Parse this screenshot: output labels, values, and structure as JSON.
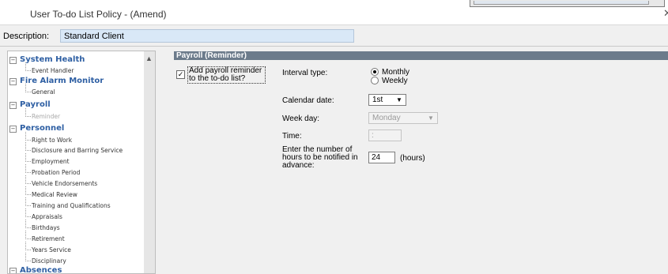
{
  "window": {
    "title": "User To-do List Policy - (Amend)",
    "close_glyph": "✕"
  },
  "description": {
    "label": "Description:",
    "value": "Standard Client"
  },
  "tree": {
    "categories": [
      {
        "label": "System Health",
        "children": [
          "Event Handler"
        ]
      },
      {
        "label": "Fire Alarm Monitor",
        "children": [
          "General"
        ]
      },
      {
        "label": "Payroll",
        "children": [
          "Reminder"
        ],
        "selected_child": "Reminder"
      },
      {
        "label": "Personnel",
        "children": [
          "Right to Work",
          "Disclosure and Barring Service",
          "Employment",
          "Probation Period",
          "Vehicle Endorsements",
          "Medical Review",
          "Training and Qualifications",
          "Appraisals",
          "Birthdays",
          "Retirement",
          "Years Service",
          "Disciplinary"
        ]
      },
      {
        "label": "Absences",
        "children": []
      }
    ],
    "expander_glyph": "−"
  },
  "panel": {
    "header": "Payroll (Reminder)",
    "reminder_checkbox": {
      "label": "Add payroll reminder to the to-do list?",
      "checked": true,
      "glyph": "✓"
    },
    "interval": {
      "label": "Interval type:",
      "options": [
        {
          "label": "Monthly",
          "selected": true
        },
        {
          "label": "Weekly",
          "selected": false
        }
      ]
    },
    "calendar_date": {
      "label": "Calendar date:",
      "value": "1st"
    },
    "week_day": {
      "label": "Week day:",
      "value": "Monday",
      "disabled": true
    },
    "time": {
      "label": "Time:",
      "value": ":",
      "disabled": true
    },
    "hours_notice": {
      "label": "Enter the number of hours to be notified in advance:",
      "value": "24",
      "unit": "(hours)"
    },
    "dropdown_glyph": "▼"
  }
}
